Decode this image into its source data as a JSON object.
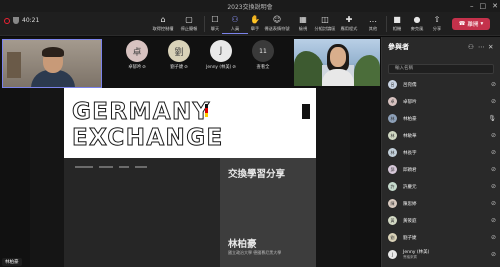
{
  "window": {
    "title": "2023交換說明會",
    "min_label": "–",
    "max_label": "□",
    "close_label": "✕"
  },
  "meeting": {
    "elapsed": "40:21"
  },
  "toolbar": {
    "buttons": [
      {
        "id": "sharing-control",
        "label": "取得控制權",
        "icon": "⌂"
      },
      {
        "id": "stop-share",
        "label": "停止簡報",
        "icon": "▢"
      },
      {
        "id": "chat",
        "label": "聊天",
        "icon": "☐"
      },
      {
        "id": "people",
        "label": "人員",
        "icon": "⚇",
        "active": true
      },
      {
        "id": "raise",
        "label": "舉手",
        "icon": "✋"
      },
      {
        "id": "react",
        "label": "傳送表情符號",
        "icon": "☺"
      },
      {
        "id": "view",
        "label": "檢視",
        "icon": "▦"
      },
      {
        "id": "rooms",
        "label": "分組討論區",
        "icon": "◫"
      },
      {
        "id": "apps",
        "label": "應用程式",
        "icon": "✚"
      },
      {
        "id": "more",
        "label": "其他",
        "icon": "…"
      },
      {
        "id": "camera",
        "label": "相機",
        "icon": "■"
      },
      {
        "id": "mic",
        "label": "麥克風",
        "icon": "●"
      },
      {
        "id": "sharecontent",
        "label": "分享",
        "icon": "⇧"
      }
    ],
    "leave_label": "離開",
    "leave_color": "#c4314b"
  },
  "video": {
    "self_label": "林柏豪",
    "avatars": [
      {
        "initial": "卓",
        "name": "卓郁吟",
        "color": "#d7c2c0"
      },
      {
        "initial": "劉",
        "name": "劉子婕",
        "color": "#d9d2b8"
      },
      {
        "initial": "J",
        "name": "Jenny (林美)",
        "color": "#e9e9e9"
      },
      {
        "initial": "11",
        "name": "查看全",
        "color": "#3a3a3a"
      }
    ]
  },
  "slide": {
    "title": "GERMANY EXCHANGE",
    "subtitle": "交換學習分享",
    "presenter": "林柏豪",
    "presenter_sub": "國立政治大學 德國慕尼黑大學"
  },
  "panel": {
    "title": "參與者",
    "search_placeholder": "輸入名稱",
    "participants": [
      {
        "initial": "呂",
        "name": "呂宛儒",
        "color": "#c9d4e3"
      },
      {
        "initial": "卓",
        "name": "卓郁吟",
        "color": "#d7c2c0"
      },
      {
        "initial": "林",
        "name": "林柏豪",
        "color": "#8da0b8",
        "speaking": true
      },
      {
        "initial": "林",
        "name": "林敏華",
        "color": "#cfd7c2"
      },
      {
        "initial": "林",
        "name": "林長宇",
        "color": "#c2cfd9"
      },
      {
        "initial": "邱",
        "name": "邱穎君",
        "color": "#d6c8d9"
      },
      {
        "initial": "許",
        "name": "許慶元",
        "color": "#c5d9cc"
      },
      {
        "initial": "陳",
        "name": "陳思婷",
        "color": "#d9cbc1"
      },
      {
        "initial": "黃",
        "name": "黃筱庭",
        "color": "#d3d9c4"
      },
      {
        "initial": "劉",
        "name": "劉子婕",
        "color": "#d9d2b8"
      },
      {
        "initial": "J",
        "name": "Jenny (林美)",
        "sub": "會議來賓",
        "color": "#e9e9e9"
      }
    ]
  }
}
